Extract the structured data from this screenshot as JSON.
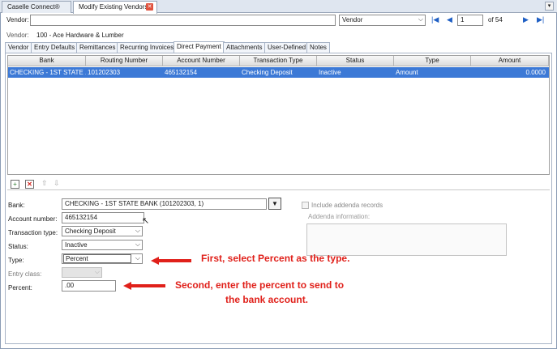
{
  "doc_tabs": [
    "Caselle Connect®",
    "Modify Existing Vendors"
  ],
  "vendor_bar": {
    "label": "Vendor:",
    "value": "",
    "search_by": "Vendor",
    "record": "1",
    "of_total": "of 54"
  },
  "vendor_info": {
    "label": "Vendor:",
    "value": "100  -  Ace Hardware & Lumber"
  },
  "tabs": [
    "Vendor",
    "Entry Defaults",
    "Remittances",
    "Recurring Invoices",
    "Direct Payment",
    "Attachments",
    "User-Defined",
    "Notes"
  ],
  "active_tab": "Direct Payment",
  "grid": {
    "columns": [
      "Bank",
      "Routing Number",
      "Account Number",
      "Transaction Type",
      "Status",
      "Type",
      "Amount"
    ],
    "rows": [
      [
        "CHECKING - 1ST STATE ...",
        "101202303",
        "465132154",
        "Checking Deposit",
        "Inactive",
        "Amount",
        "0.0000"
      ]
    ]
  },
  "form": {
    "bank_label": "Bank:",
    "bank_value": "CHECKING - 1ST STATE BANK (101202303, 1)",
    "account_label": "Account number:",
    "account_value": "465132154",
    "transaction_type_label": "Transaction type:",
    "transaction_type_value": "Checking Deposit",
    "status_label": "Status:",
    "status_value": "Inactive",
    "type_label": "Type:",
    "type_value": "Percent",
    "entry_class_label": "Entry class:",
    "entry_class_value": "",
    "percent_label": "Percent:",
    "percent_value": ".00",
    "addenda_checkbox_label": "Include addenda records",
    "addenda_info_label": "Addenda information:"
  },
  "annotations": {
    "first": "First, select Percent as the type.",
    "second_line1": "Second, enter the percent to send to",
    "second_line2": "the bank account."
  },
  "colors": {
    "selection": "#3c79d6",
    "annotation": "#e0201a"
  }
}
